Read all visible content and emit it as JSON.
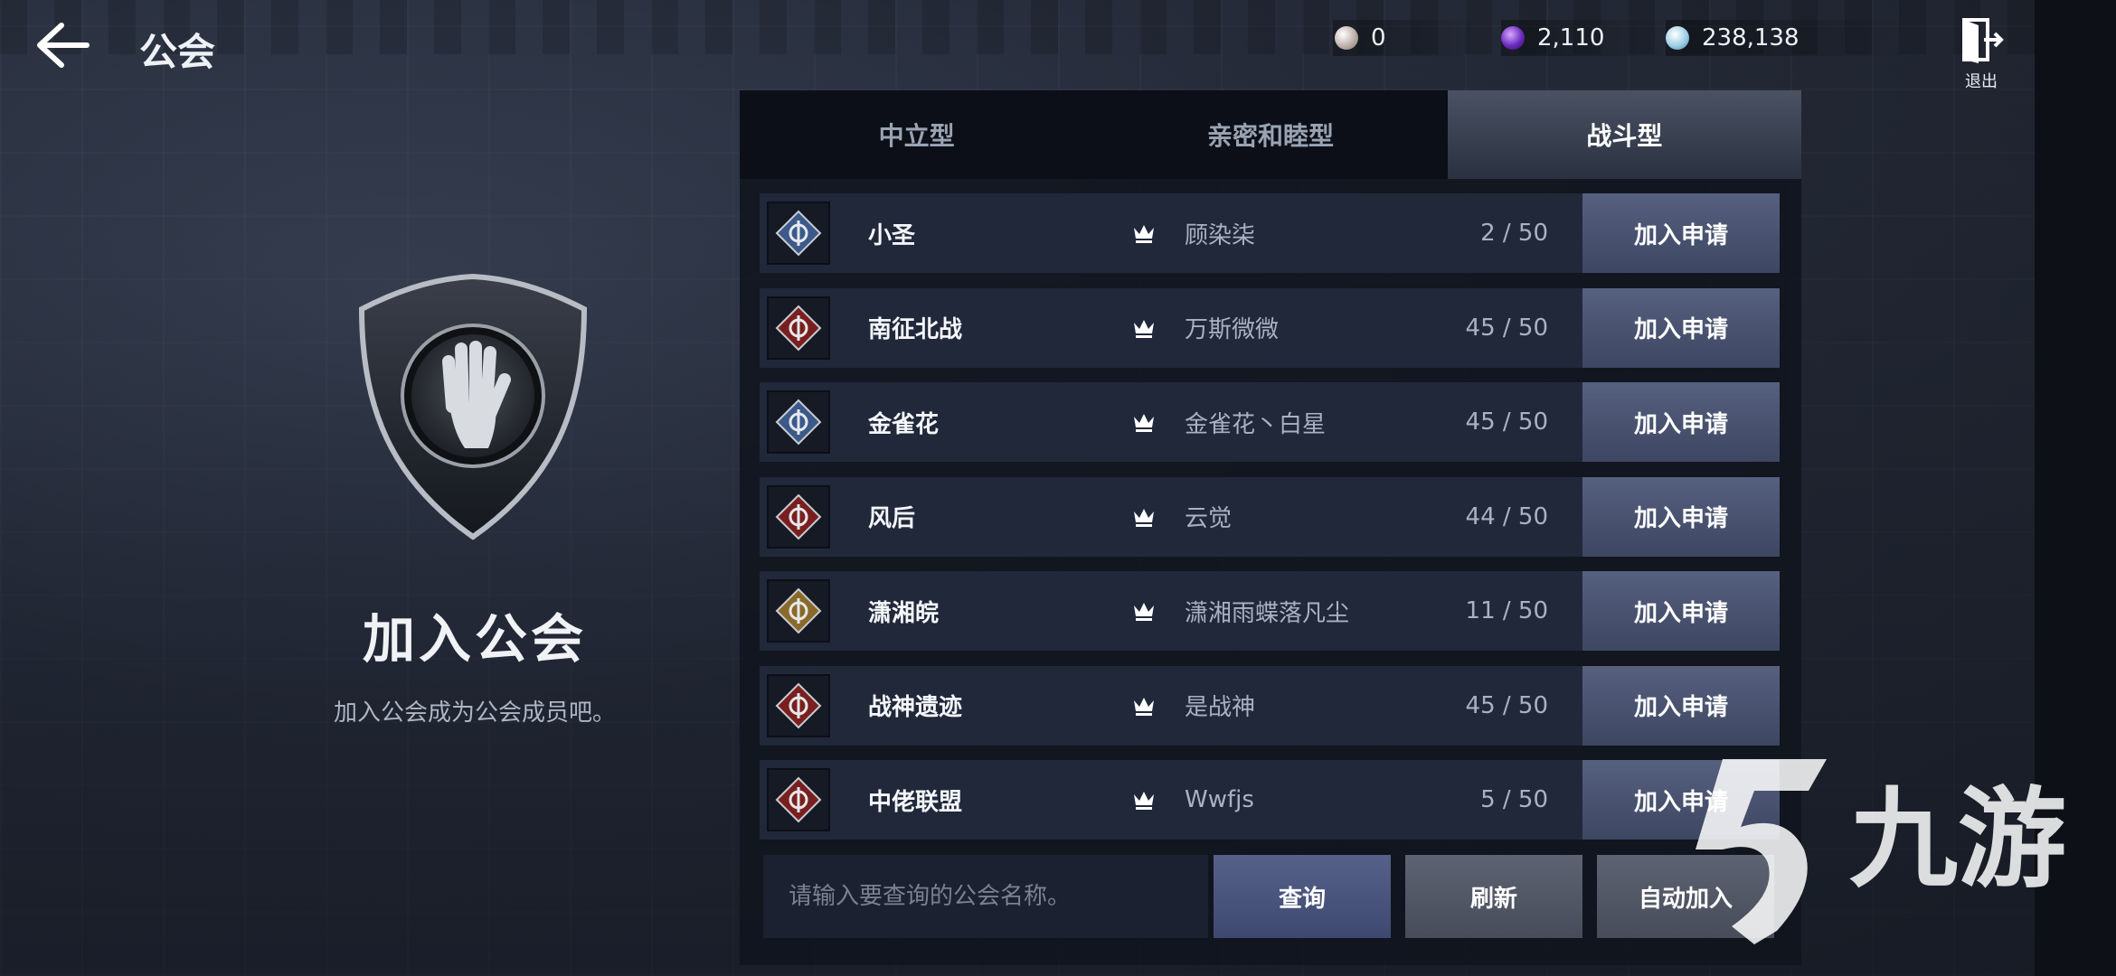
{
  "header": {
    "title": "公会",
    "exit_label": "退出"
  },
  "currencies": [
    {
      "icon": "pearl-coin-icon",
      "value": "0"
    },
    {
      "icon": "purple-gem-icon",
      "value": "2,110"
    },
    {
      "icon": "silver-coin-icon",
      "value": "238,138"
    }
  ],
  "left": {
    "title": "加入公会",
    "subtitle": "加入公会成为公会成员吧。"
  },
  "tabs": [
    {
      "label": "中立型",
      "active": false
    },
    {
      "label": "亲密和睦型",
      "active": false
    },
    {
      "label": "战斗型",
      "active": true
    }
  ],
  "guilds": [
    {
      "name": "小圣",
      "leader": "顾染柒",
      "members": "2 / 50",
      "apply": "加入申请",
      "emblem_color": "#3b5a8a"
    },
    {
      "name": "南征北战",
      "leader": "万斯微微",
      "members": "45 / 50",
      "apply": "加入申请",
      "emblem_color": "#7a1f1f"
    },
    {
      "name": "金雀花",
      "leader": "金雀花丶白星",
      "members": "45 / 50",
      "apply": "加入申请",
      "emblem_color": "#3b5a8a"
    },
    {
      "name": "风后",
      "leader": "云觉",
      "members": "44 / 50",
      "apply": "加入申请",
      "emblem_color": "#7a1f1f"
    },
    {
      "name": "潇湘皖",
      "leader": "潇湘雨蝶落凡尘",
      "members": "11 / 50",
      "apply": "加入申请",
      "emblem_color": "#8a6a2a"
    },
    {
      "name": "战神遗迹",
      "leader": "是战神",
      "members": "45 / 50",
      "apply": "加入申请",
      "emblem_color": "#7a1f1f"
    },
    {
      "name": "中佬联盟",
      "leader": "Wwfjs",
      "members": "5 / 50",
      "apply": "加入申请",
      "emblem_color": "#7a1f1f"
    }
  ],
  "search": {
    "placeholder": "请输入要查询的公会名称。"
  },
  "buttons": {
    "query": "查询",
    "refresh": "刷新",
    "auto_join": "自动加入"
  },
  "watermark": {
    "text": "九游"
  },
  "colors": {
    "apply_button": "#4a5472",
    "panel": "#10141e",
    "active_tab": "#3a4252"
  }
}
